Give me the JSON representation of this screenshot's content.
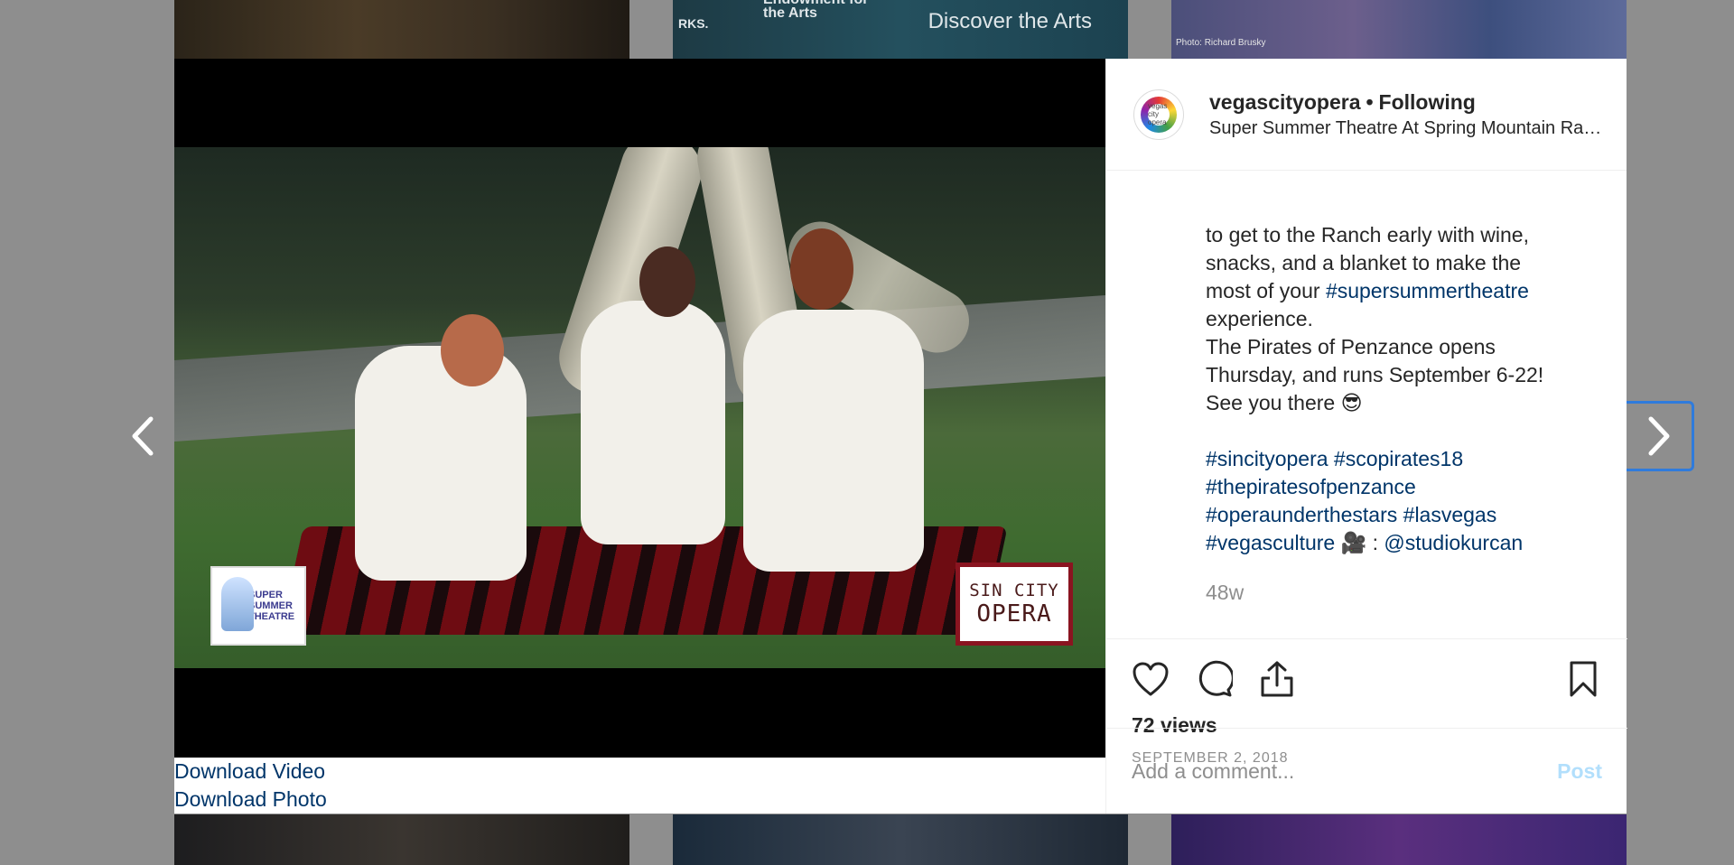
{
  "background_tiles": {
    "top_middle": {
      "text_left": "RKS.",
      "text_mid": "Endowment for the Arts",
      "text_right": "Discover the Arts"
    },
    "top_right": {
      "credit": "Photo: Richard Brusky"
    }
  },
  "navigation": {
    "prev_icon": "chevron-left-icon",
    "next_icon": "chevron-right-icon"
  },
  "media": {
    "logo_left_text": "SUPER SUMMER THEATRE",
    "logo_right_line1": "SIN CITY",
    "logo_right_line2": "OPERA"
  },
  "downloads": {
    "video": "Download Video",
    "photo": "Download Photo"
  },
  "post_header": {
    "avatar_text": "vegas city opera",
    "username": "vegascityopera",
    "separator": "•",
    "follow_state": "Following",
    "location": "Super Summer Theatre At Spring Mountain Ranch"
  },
  "caption": {
    "line1": "to get to the Ranch early with wine,",
    "line2": "snacks, and a blanket to make the",
    "line3_prefix": "most of your ",
    "line3_tag": "#supersummertheatre",
    "line4": "experience.",
    "line5": "The Pirates of Penzance opens",
    "line6": "Thursday, and runs September 6-22!",
    "line7": "See you there 😎",
    "tags_line1": "#sincityopera #scopirates18",
    "tags_line2": "#thepiratesofpenzance",
    "tags_line3": "#operaunderthestars #lasvegas",
    "tags_line4_tag": "#vegasculture",
    "tags_line4_mid": " 🎥 : ",
    "tags_line4_mention": "@studiokurcan",
    "timestamp": "48w"
  },
  "actions": {
    "like_icon": "heart-icon",
    "comment_icon": "comment-bubble-icon",
    "share_icon": "share-icon",
    "save_icon": "bookmark-icon",
    "views": "72 views",
    "date": "SEPTEMBER 2, 2018"
  },
  "comment": {
    "placeholder": "Add a comment...",
    "post_label": "Post"
  },
  "colors": {
    "link": "#003569",
    "post_disabled": "#b2dffc",
    "muted": "#8e8e8e"
  }
}
